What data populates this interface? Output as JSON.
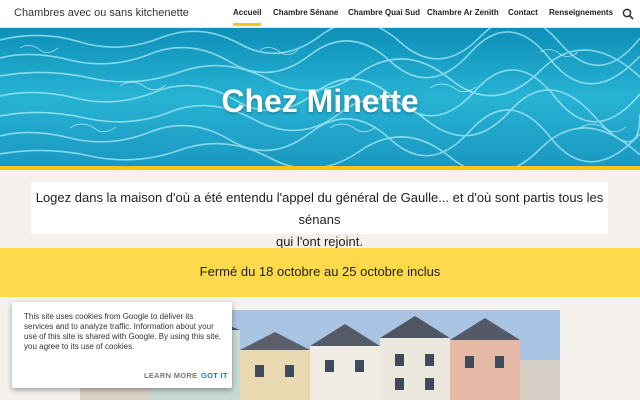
{
  "header": {
    "site_title": "Chambres avec ou sans kitchenette",
    "nav": [
      {
        "label": "Accueil",
        "active": true
      },
      {
        "label": "Chambre Sénane",
        "active": false
      },
      {
        "label": "Chambre Quai Sud",
        "active": false
      },
      {
        "label": "Chambre Ar Zenith",
        "active": false
      },
      {
        "label": "Contact",
        "active": false
      },
      {
        "label": "Renseignements",
        "active": false
      }
    ],
    "search_icon": "search-icon"
  },
  "hero": {
    "title": "Chez Minette"
  },
  "intro": {
    "line1": "Logez dans la maison d'où a été entendu l'appel du général de Gaulle... et d'où sont partis tous les sénans",
    "line2": "qui l'ont rejoint."
  },
  "notice": {
    "text": "Fermé du 18 octobre au 25 octobre inclus"
  },
  "cookie_banner": {
    "text": "This site uses cookies from Google to deliver its services and to analyze traffic. Information about your use of this site is shared with Google. By using this site, you agree to its use of cookies.",
    "learn_more": "LEARN MORE",
    "got_it": "GOT IT"
  },
  "colors": {
    "accent_yellow": "#f5c518",
    "notice_yellow": "#fdd94c",
    "link_blue": "#2a6fd6"
  }
}
